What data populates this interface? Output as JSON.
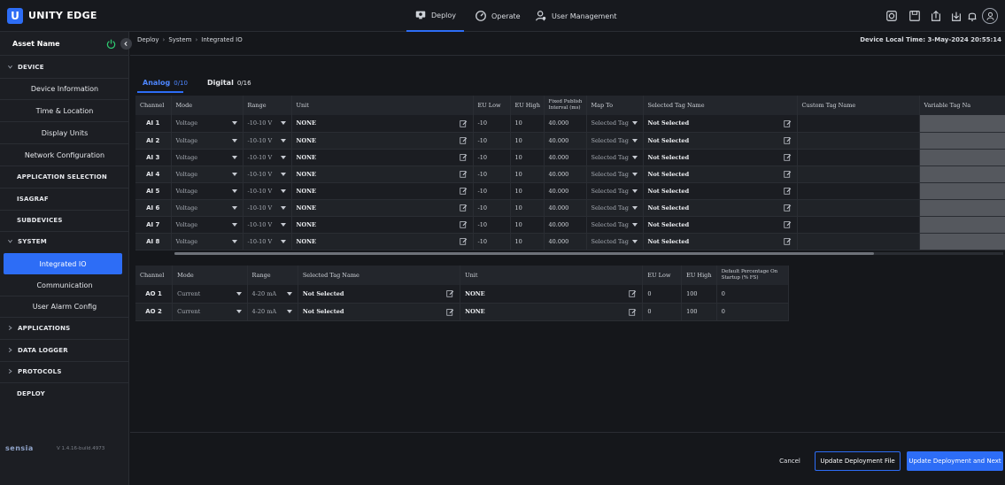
{
  "app": {
    "logo_letter": "U",
    "title": "UNITY EDGE"
  },
  "nav": {
    "deploy": "Deploy",
    "operate": "Operate",
    "user_management": "User Management"
  },
  "sidebar": {
    "asset_name": "Asset Name",
    "device": "DEVICE",
    "device_items": [
      "Device Information",
      "Time & Location",
      "Display Units",
      "Network Configuration"
    ],
    "application_selection": "APPLICATION SELECTION",
    "isagraf": "ISAGRAF",
    "subdevices": "SUBDEVICES",
    "system": "SYSTEM",
    "system_items": [
      "Integrated IO",
      "Communication",
      "User Alarm Config"
    ],
    "applications": "APPLICATIONS",
    "data_logger": "DATA LOGGER",
    "protocols": "PROTOCOLS",
    "deploy": "DEPLOY",
    "brand": "sensia",
    "version": "V 1.4.16-build.4973"
  },
  "breadcrumb": [
    "Deploy",
    "System",
    "Integrated IO"
  ],
  "device_time": "Device Local Time: 3-May-2024 20:55:14",
  "tabs": {
    "analog": "Analog",
    "analog_count": "0/10",
    "digital": "Digital",
    "digital_count": "0/16"
  },
  "analog_table": {
    "headers": [
      "Channel",
      "Mode",
      "Range",
      "Unit",
      "EU Low",
      "EU High",
      "Fixed Publish Interval (ms)",
      "Map To",
      "Selected Tag Name",
      "Custom Tag Name",
      "Variable Tag Na"
    ],
    "rows": [
      {
        "channel": "AI 1",
        "mode": "Voltage",
        "range": "-10-10 V",
        "unit": "NONE",
        "eu_low": "-10",
        "eu_high": "10",
        "interval": "40.000",
        "map_to": "Selected Tag",
        "tag": "Not Selected"
      },
      {
        "channel": "AI 2",
        "mode": "Voltage",
        "range": "-10-10 V",
        "unit": "NONE",
        "eu_low": "-10",
        "eu_high": "10",
        "interval": "40.000",
        "map_to": "Selected Tag",
        "tag": "Not Selected"
      },
      {
        "channel": "AI 3",
        "mode": "Voltage",
        "range": "-10-10 V",
        "unit": "NONE",
        "eu_low": "-10",
        "eu_high": "10",
        "interval": "40.000",
        "map_to": "Selected Tag",
        "tag": "Not Selected"
      },
      {
        "channel": "AI 4",
        "mode": "Voltage",
        "range": "-10-10 V",
        "unit": "NONE",
        "eu_low": "-10",
        "eu_high": "10",
        "interval": "40.000",
        "map_to": "Selected Tag",
        "tag": "Not Selected"
      },
      {
        "channel": "AI 5",
        "mode": "Voltage",
        "range": "-10-10 V",
        "unit": "NONE",
        "eu_low": "-10",
        "eu_high": "10",
        "interval": "40.000",
        "map_to": "Selected Tag",
        "tag": "Not Selected"
      },
      {
        "channel": "AI 6",
        "mode": "Voltage",
        "range": "-10-10 V",
        "unit": "NONE",
        "eu_low": "-10",
        "eu_high": "10",
        "interval": "40.000",
        "map_to": "Selected Tag",
        "tag": "Not Selected"
      },
      {
        "channel": "AI 7",
        "mode": "Voltage",
        "range": "-10-10 V",
        "unit": "NONE",
        "eu_low": "-10",
        "eu_high": "10",
        "interval": "40.000",
        "map_to": "Selected Tag",
        "tag": "Not Selected"
      },
      {
        "channel": "AI 8",
        "mode": "Voltage",
        "range": "-10-10 V",
        "unit": "NONE",
        "eu_low": "-10",
        "eu_high": "10",
        "interval": "40.000",
        "map_to": "Selected Tag",
        "tag": "Not Selected"
      }
    ]
  },
  "output_table": {
    "headers": [
      "Channel",
      "Mode",
      "Range",
      "Selected Tag Name",
      "Unit",
      "EU Low",
      "EU High",
      "Default Percentage On Startup (% FS)"
    ],
    "rows": [
      {
        "channel": "AO 1",
        "mode": "Current",
        "range": "4-20 mA",
        "tag": "Not Selected",
        "unit": "NONE",
        "eu_low": "0",
        "eu_high": "100",
        "default_pct": "0"
      },
      {
        "channel": "AO 2",
        "mode": "Current",
        "range": "4-20 mA",
        "tag": "Not Selected",
        "unit": "NONE",
        "eu_low": "0",
        "eu_high": "100",
        "default_pct": "0"
      }
    ]
  },
  "footer": {
    "cancel": "Cancel",
    "update_file": "Update Deployment File",
    "update_next": "Update Deployment and Next"
  },
  "colors": {
    "accent": "#2d6df6",
    "background": "#15171b",
    "panel": "#1c1e23"
  }
}
